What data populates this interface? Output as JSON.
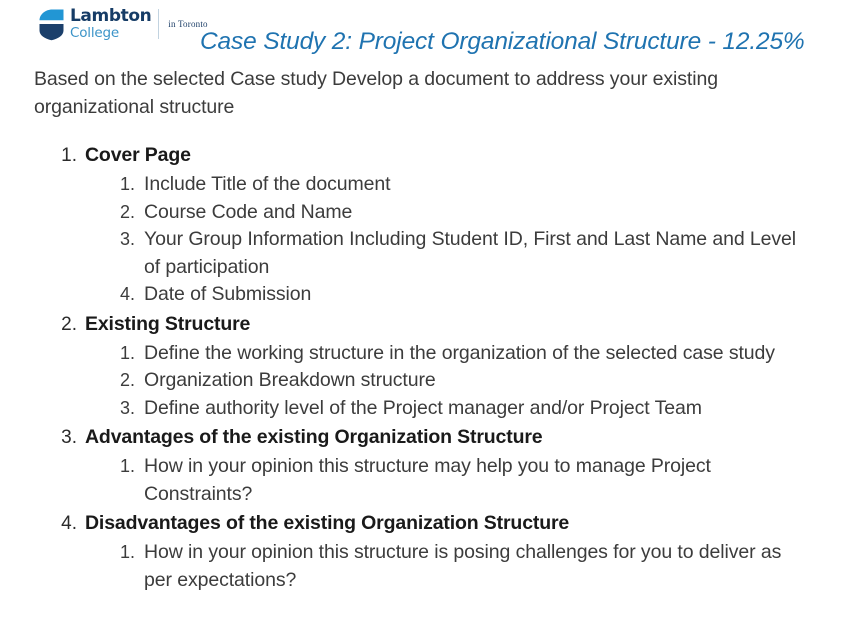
{
  "header": {
    "logo": {
      "mark_name": "lambton-shield-logo",
      "wordmark_primary": "Lambton",
      "wordmark_secondary": "College",
      "sub_label": "in Toronto",
      "color_light": "#2296d4",
      "color_dark": "#1b3f6b",
      "color_college": "#3c94c8"
    },
    "title": "Case Study 2: Project Organizational Structure - 12.25%",
    "title_color": "#1f73b0"
  },
  "body": {
    "intro": "Based on the selected Case study Develop a document to address your existing organizational structure",
    "outline": [
      {
        "number": "1.",
        "label": "Cover Page",
        "subitems": [
          {
            "number": "1.",
            "text": "Include Title of the document"
          },
          {
            "number": "2.",
            "text": "Course Code and Name"
          },
          {
            "number": "3.",
            "text": "Your Group Information Including Student ID, First and Last Name and Level of participation"
          },
          {
            "number": "4.",
            "text": "Date of Submission"
          }
        ]
      },
      {
        "number": "2.",
        "label": "Existing Structure",
        "subitems": [
          {
            "number": "1.",
            "text": "Define the working structure in the organization of the selected case study"
          },
          {
            "number": "2.",
            "text": "Organization Breakdown structure"
          },
          {
            "number": "3.",
            "text": "Define authority level of the Project manager and/or Project Team"
          }
        ]
      },
      {
        "number": "3.",
        "label": "Advantages of the existing Organization Structure",
        "subitems": [
          {
            "number": "1.",
            "text": "How in your opinion this structure may help you to manage Project Constraints?"
          }
        ]
      },
      {
        "number": "4.",
        "label": "Disadvantages of the existing Organization Structure",
        "subitems": [
          {
            "number": "1.",
            "text": "How in your opinion this structure is posing challenges for you to deliver as per expectations?"
          }
        ]
      }
    ]
  }
}
